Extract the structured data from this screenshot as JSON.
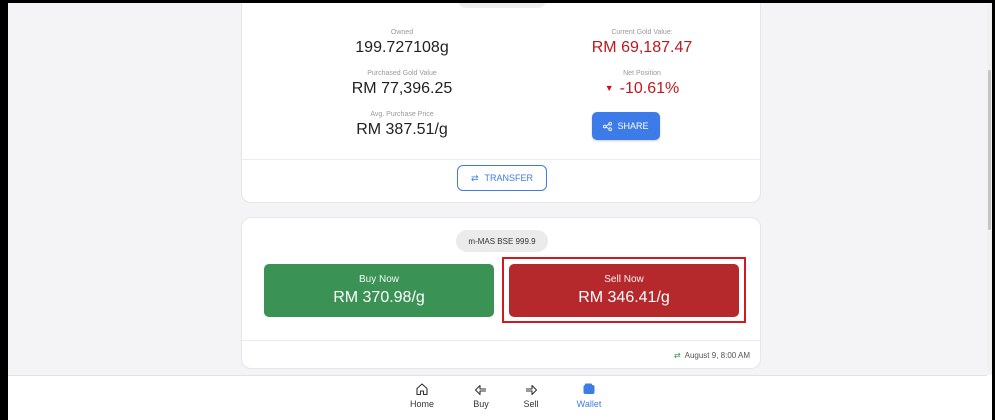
{
  "summary": {
    "owned_label": "Owned",
    "owned_value": "199.727108g",
    "current_value_label": "Current Gold Value:",
    "current_value": "RM 69,187.47",
    "purchased_label": "Purchased Gold Value",
    "purchased_value": "RM 77,396.25",
    "net_label": "Net Position",
    "net_value": "-10.61%",
    "avg_label": "Avg. Purchase Price",
    "avg_value": "RM 387.51/g",
    "share_label": "SHARE",
    "transfer_label": "TRANSFER"
  },
  "price_card": {
    "asset_name": "m-MAS BSE 999.9",
    "buy_label": "Buy Now",
    "buy_price": "RM 370.98/g",
    "sell_label": "Sell Now",
    "sell_price": "RM 346.41/g",
    "updated_at": "August 9, 8:00 AM"
  },
  "nav": {
    "items": [
      {
        "label": "Home",
        "icon": "home-icon"
      },
      {
        "label": "Buy",
        "icon": "buy-icon"
      },
      {
        "label": "Sell",
        "icon": "sell-icon"
      },
      {
        "label": "Wallet",
        "icon": "wallet-icon",
        "active": true
      }
    ]
  },
  "colors": {
    "accent": "#3d7be8",
    "buy": "#3a9254",
    "sell": "#b5292d",
    "negative": "#c0171d",
    "highlight": "#d01a1f"
  }
}
